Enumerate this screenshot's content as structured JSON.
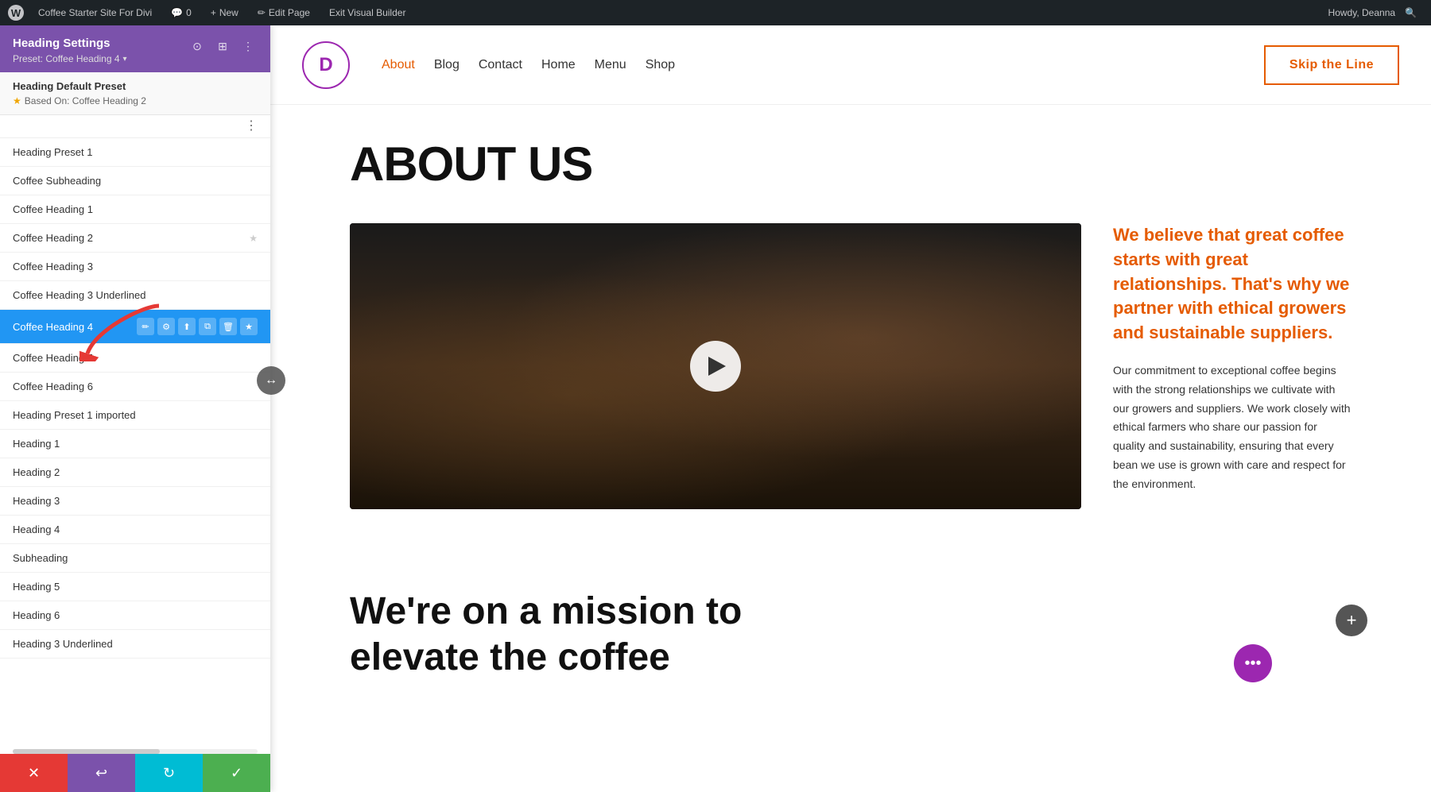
{
  "admin_bar": {
    "wp_logo": "W",
    "site_name": "Coffee Starter Site For Divi",
    "comment_count": "0",
    "new_label": "New",
    "edit_page_label": "Edit Page",
    "exit_builder_label": "Exit Visual Builder",
    "howdy": "Howdy, Deanna"
  },
  "sidebar": {
    "title": "Heading Settings",
    "preset_label": "Preset: Coffee Heading 4",
    "default_preset": {
      "title": "Heading Default Preset",
      "based_on": "Based On: Coffee Heading 2"
    },
    "presets": [
      {
        "id": "heading-preset-1",
        "label": "Heading Preset 1",
        "active": false,
        "star": false
      },
      {
        "id": "coffee-subheading",
        "label": "Coffee Subheading",
        "active": false,
        "star": false
      },
      {
        "id": "coffee-heading-1",
        "label": "Coffee Heading 1",
        "active": false,
        "star": false
      },
      {
        "id": "coffee-heading-2",
        "label": "Coffee Heading 2",
        "active": false,
        "star": true
      },
      {
        "id": "coffee-heading-3",
        "label": "Coffee Heading 3",
        "active": false,
        "star": false
      },
      {
        "id": "coffee-heading-3-underlined",
        "label": "Coffee Heading 3 Underlined",
        "active": false,
        "star": false
      },
      {
        "id": "coffee-heading-4",
        "label": "Coffee Heading 4",
        "active": true,
        "star": true
      },
      {
        "id": "coffee-heading-5",
        "label": "Coffee Heading 5",
        "active": false,
        "star": false
      },
      {
        "id": "coffee-heading-6",
        "label": "Coffee Heading 6",
        "active": false,
        "star": false
      },
      {
        "id": "heading-preset-1-imported",
        "label": "Heading Preset 1 imported",
        "active": false,
        "star": false
      },
      {
        "id": "heading-1",
        "label": "Heading 1",
        "active": false,
        "star": false
      },
      {
        "id": "heading-2",
        "label": "Heading 2",
        "active": false,
        "star": false
      },
      {
        "id": "heading-3",
        "label": "Heading 3",
        "active": false,
        "star": false
      },
      {
        "id": "heading-4",
        "label": "Heading 4",
        "active": false,
        "star": false
      },
      {
        "id": "subheading",
        "label": "Subheading",
        "active": false,
        "star": false
      },
      {
        "id": "heading-5",
        "label": "Heading 5",
        "active": false,
        "star": false
      },
      {
        "id": "heading-6",
        "label": "Heading 6",
        "active": false,
        "star": false
      },
      {
        "id": "heading-3-underlined",
        "label": "Heading 3 Underlined",
        "active": false,
        "star": false
      }
    ],
    "footer": {
      "cancel_icon": "✕",
      "undo_icon": "↩",
      "redo_icon": "↻",
      "save_icon": "✓"
    }
  },
  "site": {
    "logo_letter": "D",
    "nav_items": [
      "About",
      "Blog",
      "Contact",
      "Home",
      "Menu",
      "Shop"
    ],
    "active_nav": "About",
    "skip_line_btn": "Skip the Line"
  },
  "page": {
    "about_heading": "ABOUT US",
    "highlight_text": "We believe that great coffee starts with great relationships. That's why we partner with ethical growers and sustainable suppliers.",
    "body_text": "Our commitment to exceptional coffee begins with the strong relationships we cultivate with our growers and suppliers. We work closely with ethical farmers who share our passion for quality and sustainability, ensuring that every bean we use is grown with care and respect for the environment.",
    "mission_heading_line1": "We're on a mission to",
    "mission_heading_line2": "elevate the coffee"
  },
  "colors": {
    "purple": "#7b52ab",
    "orange": "#e55b00",
    "blue_active": "#2196F3",
    "green": "#4caf50",
    "teal": "#00bcd4",
    "red": "#e53935"
  },
  "icons": {
    "pencil": "✏",
    "gear": "⚙",
    "upload": "⬆",
    "copy": "⧉",
    "trash": "🗑",
    "star": "★"
  }
}
